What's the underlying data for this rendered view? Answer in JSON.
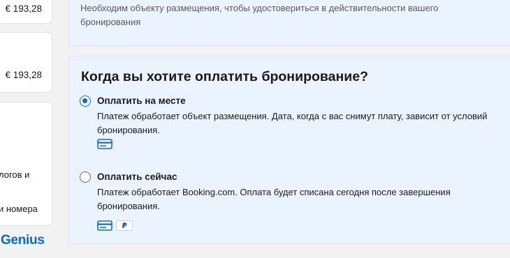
{
  "sidebar": {
    "price_1": "€ 193,28",
    "price_2": "€ 193,28",
    "text_1": "логов и",
    "text_2": "и номера",
    "genius_logo": "Genius"
  },
  "info_panel": {
    "text": "Необходим объекту размещения, чтобы удостовериться в действительности вашего бронирования"
  },
  "payment": {
    "title": "Когда вы хотите оплатить бронирование?",
    "options": [
      {
        "label": "Оплатить на месте",
        "description": "Платеж обработает объект размещения. Дата, когда с вас снимут плату, зависит от условий бронирования.",
        "selected": true,
        "icons": [
          "credit-card-icon"
        ]
      },
      {
        "label": "Оплатить сейчас",
        "description": "Платеж обработает Booking.com. Оплата будет списана сегодня после завершения бронирования.",
        "selected": false,
        "icons": [
          "credit-card-icon",
          "paypal-icon"
        ]
      }
    ]
  },
  "colors": {
    "accent": "#006ce4",
    "panel_bg": "#ebf3ff"
  }
}
